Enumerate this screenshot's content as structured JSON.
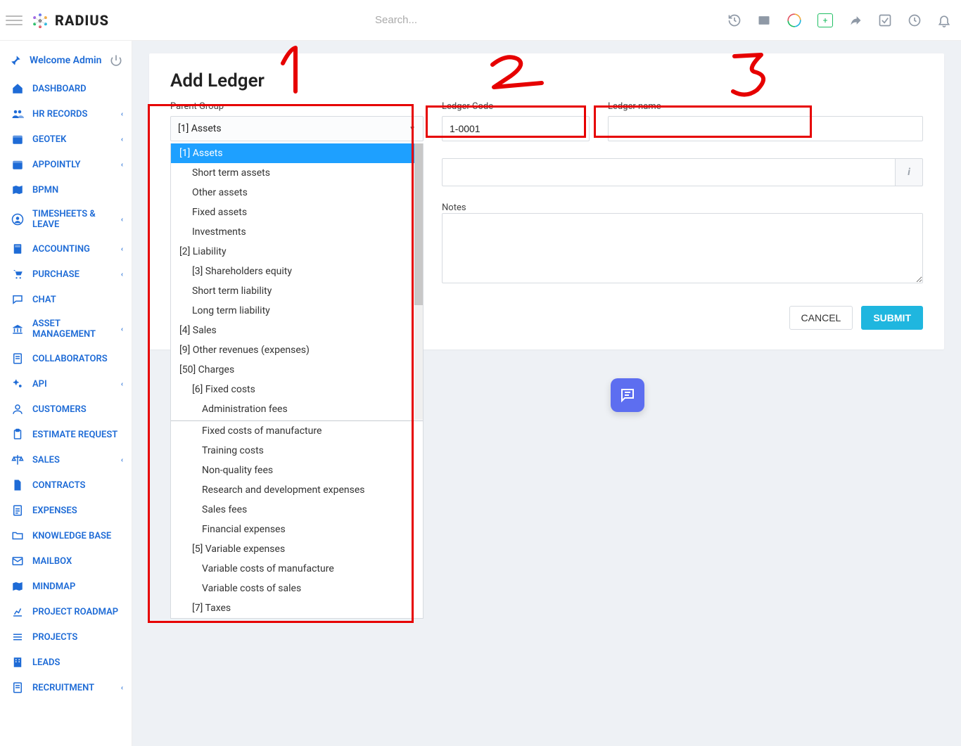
{
  "brand": {
    "name": "RADIUS"
  },
  "search": {
    "placeholder": "Search..."
  },
  "welcome": {
    "text": "Welcome Admin"
  },
  "sidebar": {
    "items": [
      {
        "label": "DASHBOARD",
        "icon": "home",
        "expandable": false
      },
      {
        "label": "HR RECORDS",
        "icon": "users",
        "expandable": true
      },
      {
        "label": "GEOTEK",
        "icon": "calendar",
        "expandable": true
      },
      {
        "label": "APPOINTLY",
        "icon": "calendar",
        "expandable": true
      },
      {
        "label": "BPMN",
        "icon": "map",
        "expandable": false
      },
      {
        "label": "TIMESHEETS & LEAVE",
        "icon": "user-circle",
        "expandable": true
      },
      {
        "label": "ACCOUNTING",
        "icon": "calculator",
        "expandable": true
      },
      {
        "label": "PURCHASE",
        "icon": "cart",
        "expandable": true
      },
      {
        "label": "CHAT",
        "icon": "chat",
        "expandable": false
      },
      {
        "label": "ASSET MANAGEMENT",
        "icon": "bank",
        "expandable": true
      },
      {
        "label": "COLLABORATORS",
        "icon": "doc",
        "expandable": false
      },
      {
        "label": "API",
        "icon": "cogs",
        "expandable": true
      },
      {
        "label": "CUSTOMERS",
        "icon": "user",
        "expandable": false
      },
      {
        "label": "ESTIMATE REQUEST",
        "icon": "clipboard",
        "expandable": false
      },
      {
        "label": "SALES",
        "icon": "scales",
        "expandable": true
      },
      {
        "label": "CONTRACTS",
        "icon": "file",
        "expandable": false
      },
      {
        "label": "EXPENSES",
        "icon": "file-lines",
        "expandable": false
      },
      {
        "label": "KNOWLEDGE BASE",
        "icon": "folder",
        "expandable": false
      },
      {
        "label": "MAILBOX",
        "icon": "mail",
        "expandable": false
      },
      {
        "label": "MINDMAP",
        "icon": "map",
        "expandable": false
      },
      {
        "label": "PROJECT ROADMAP",
        "icon": "chart",
        "expandable": false
      },
      {
        "label": "PROJECTS",
        "icon": "lines",
        "expandable": false
      },
      {
        "label": "LEADS",
        "icon": "building",
        "expandable": false
      },
      {
        "label": "RECRUITMENT",
        "icon": "doc",
        "expandable": true
      }
    ]
  },
  "page": {
    "title": "Add Ledger",
    "parent_label": "Parent Group",
    "parent_selected": "[1] Assets",
    "code_label": "Ledger Code",
    "code_value": "1-0001",
    "name_label": "Ledger name",
    "name_value": "",
    "notes_label": "Notes",
    "cancel": "CANCEL",
    "submit": "SUBMIT"
  },
  "dropdown": {
    "items": [
      {
        "text": "[1] Assets",
        "level": 1,
        "selected": true
      },
      {
        "text": "Short term assets",
        "level": 2
      },
      {
        "text": "Other assets",
        "level": 2
      },
      {
        "text": "Fixed assets",
        "level": 2
      },
      {
        "text": "Investments",
        "level": 2
      },
      {
        "text": "[2] Liability",
        "level": 1
      },
      {
        "text": "[3] Shareholders equity",
        "level": 2
      },
      {
        "text": "Short term liability",
        "level": 2
      },
      {
        "text": "Long term liability",
        "level": 2
      },
      {
        "text": "[4] Sales",
        "level": 1
      },
      {
        "text": "[9] Other revenues (expenses)",
        "level": 1
      },
      {
        "text": "[50] Charges",
        "level": 1
      },
      {
        "text": "[6] Fixed costs",
        "level": 2
      },
      {
        "text": "Administration fees",
        "level": 3
      },
      {
        "text": "Fixed costs of manufacture",
        "level": 3
      },
      {
        "text": "Training costs",
        "level": 3
      },
      {
        "text": "Non-quality fees",
        "level": 3
      },
      {
        "text": "Research and development expenses",
        "level": 3
      },
      {
        "text": "Sales fees",
        "level": 3
      },
      {
        "text": "Financial expenses",
        "level": 3
      },
      {
        "text": "[5] Variable expenses",
        "level": 2
      },
      {
        "text": "Variable costs of manufacture",
        "level": 3
      },
      {
        "text": "Variable costs of sales",
        "level": 3
      },
      {
        "text": "[7] Taxes",
        "level": 2
      }
    ]
  }
}
